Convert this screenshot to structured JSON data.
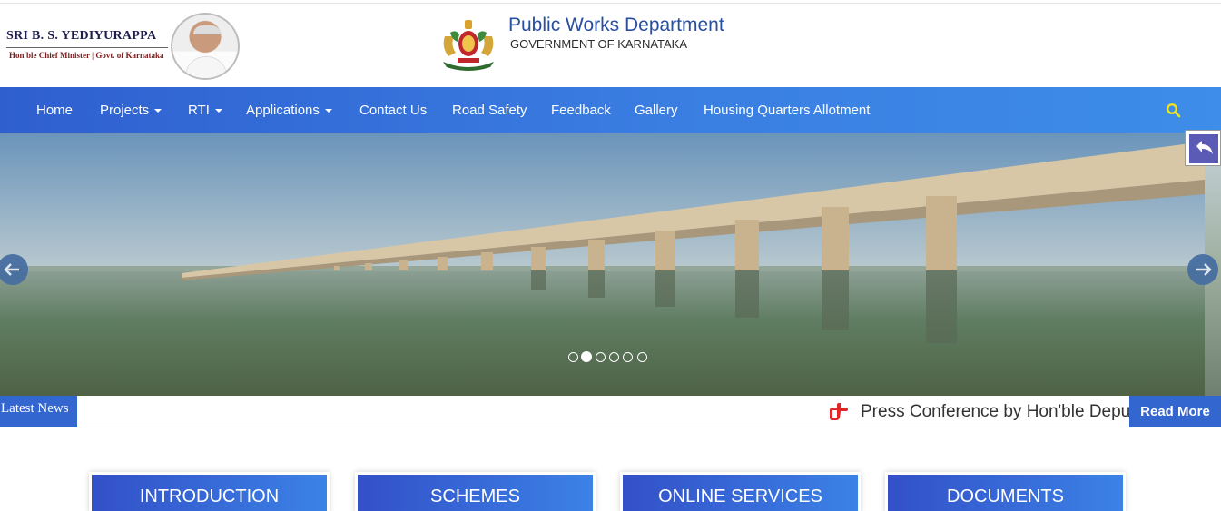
{
  "header": {
    "cm_name": "SRI B. S. YEDIYURAPPA",
    "cm_title": "Hon'ble Chief Minister | Govt. of Karnataka",
    "dept_name": "Public Works Department",
    "dept_sub": "GOVERNMENT OF KARNATAKA"
  },
  "nav": {
    "items": [
      {
        "label": "Home",
        "dropdown": false
      },
      {
        "label": "Projects",
        "dropdown": true
      },
      {
        "label": "RTI",
        "dropdown": true
      },
      {
        "label": "Applications",
        "dropdown": true
      },
      {
        "label": "Contact Us",
        "dropdown": false
      },
      {
        "label": "Road Safety",
        "dropdown": false
      },
      {
        "label": "Feedback",
        "dropdown": false
      },
      {
        "label": "Gallery",
        "dropdown": false
      },
      {
        "label": "Housing Quarters Allotment",
        "dropdown": false
      }
    ],
    "search_icon": "search-icon",
    "search_color": "#f2e21c"
  },
  "slider": {
    "slide_count": 6,
    "active_slide": 2,
    "prev_icon": "arrow-left-icon",
    "next_icon": "arrow-right-icon",
    "back_icon": "reply-arrow-icon"
  },
  "news": {
    "label": "Latest News",
    "ticker_text": "Press Conference by Hon'ble Deputy Chief Minister",
    "icon": "pointing-hand-icon",
    "read_more": "Read More"
  },
  "cards": [
    {
      "label": "INTRODUCTION"
    },
    {
      "label": "SCHEMES"
    },
    {
      "label": "ONLINE SERVICES"
    },
    {
      "label": "DOCUMENTS"
    }
  ],
  "colors": {
    "nav_start": "#2f5fcf",
    "nav_end": "#3d8de9",
    "accent": "#3466d0",
    "dept_title": "#2a4fa0"
  }
}
